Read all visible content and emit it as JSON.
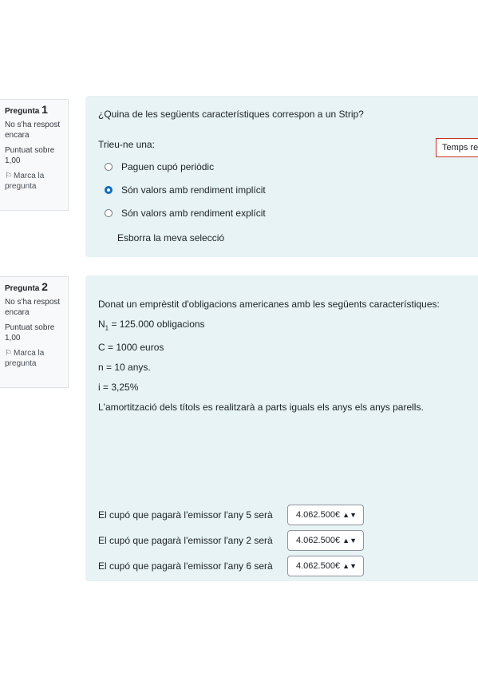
{
  "q1": {
    "label": "Pregunta",
    "number": "1",
    "status": "No s'ha respost encara",
    "marks": "Puntuat sobre 1,00",
    "flag": "Marca la pregunta",
    "text": "¿Quina de les següents característiques correspon a un Strip?",
    "prompt": "Trieu-ne una:",
    "options": [
      {
        "label": "Paguen cupó periòdic",
        "checked": false
      },
      {
        "label": "Són valors amb rendiment implícit",
        "checked": true
      },
      {
        "label": "Són valors amb rendiment explícit",
        "checked": false
      }
    ],
    "clear": "Esborra la meva selecció"
  },
  "timer": "Temps re",
  "q2": {
    "label": "Pregunta",
    "number": "2",
    "status": "No s'ha respost encara",
    "marks": "Puntuat sobre 1,00",
    "flag": "Marca la pregunta",
    "intro": "Donat un emprèstit d'obligacions americanes amb les següents característiques:",
    "n1_prefix": "N",
    "n1_sub": "1",
    "n1_value": " = 125.000 obligacions",
    "c": "C = 1000 euros",
    "n": "n = 10 anys.",
    "i": "i = 3,25%",
    "note": "L'amortització dels títols es realitzarà a parts iguals els anys els anys parells.",
    "answers": [
      {
        "label": "El cupó que pagarà l'emissor l'any 5 serà",
        "value": "4.062.500€"
      },
      {
        "label": "El cupó que pagarà l'emissor l'any 2 serà",
        "value": "4.062.500€"
      },
      {
        "label": "El cupó que pagarà l'emissor l'any 6 serà",
        "value": "4.062.500€"
      }
    ]
  }
}
